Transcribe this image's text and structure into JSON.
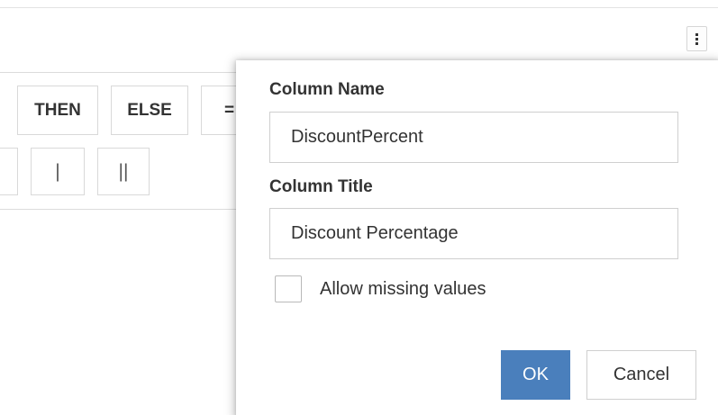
{
  "toolbar": {
    "menu_icon": "more-vertical-icon"
  },
  "expression_builder": {
    "row1": [
      "THEN",
      "ELSE",
      "="
    ],
    "row2": [
      "",
      "|",
      "||"
    ]
  },
  "column_dialog": {
    "column_name_label": "Column Name",
    "column_name_value": "DiscountPercent",
    "column_title_label": "Column Title",
    "column_title_value": "Discount Percentage",
    "allow_missing_label": "Allow missing values",
    "allow_missing_checked": false,
    "ok_label": "OK",
    "cancel_label": "Cancel"
  },
  "colors": {
    "primary": "#4a7fbc",
    "border": "#d9d9d9",
    "text": "#333333"
  }
}
